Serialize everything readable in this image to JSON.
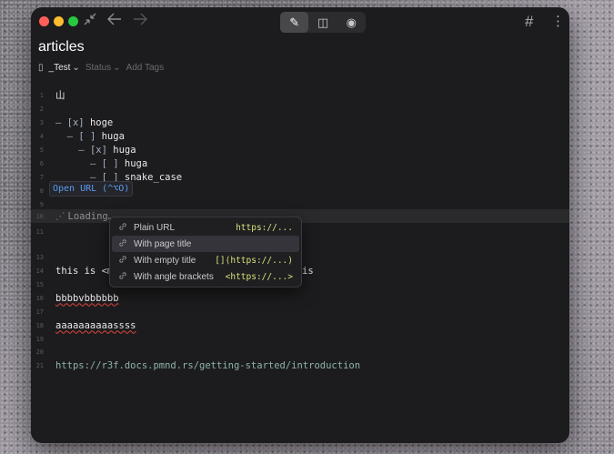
{
  "toolbar": {
    "collapse_icon": "collapse-arrows-icon",
    "back_icon": "arrow-left-icon",
    "forward_icon": "arrow-right-icon",
    "modes": [
      {
        "name": "edit",
        "icon": "pencil-icon",
        "glyph": "✎",
        "active": true
      },
      {
        "name": "split",
        "icon": "split-view-icon",
        "glyph": "◫",
        "active": false
      },
      {
        "name": "preview",
        "icon": "eye-icon",
        "glyph": "◉",
        "active": false
      }
    ],
    "hash_glyph": "#",
    "more_glyph": "⋮"
  },
  "note": {
    "title": "articles",
    "notebook": "_Test",
    "status": "Status",
    "add_tags": "Add Tags"
  },
  "editor": {
    "lines": [
      {
        "n": "1",
        "text": "山"
      },
      {
        "n": "2",
        "text": ""
      },
      {
        "n": "3",
        "text": "hoge",
        "dash": "– ",
        "check": "[x] ",
        "indent": ""
      },
      {
        "n": "4",
        "text": "huga",
        "dash": "– ",
        "check": "[ ] ",
        "indent": "  "
      },
      {
        "n": "5",
        "text": "huga",
        "dash": "– ",
        "check": "[x] ",
        "indent": "    "
      },
      {
        "n": "6",
        "text": "huga",
        "dash": "– ",
        "check": "[ ] ",
        "indent": "      "
      },
      {
        "n": "7",
        "text": "snake_case",
        "dash": "– ",
        "check": "[ ] ",
        "indent": "      "
      },
      {
        "n": "8",
        "text": ""
      },
      {
        "n": "9",
        "text": ""
      },
      {
        "n": "10",
        "text": "Loading…",
        "spinner": "⋰"
      },
      {
        "n": "11",
        "text": ""
      },
      {
        "n": "13",
        "text": ""
      },
      {
        "n": "14",
        "text_a": "this is <m",
        "text_b": "is"
      },
      {
        "n": "15",
        "text": ""
      },
      {
        "n": "16",
        "text": "bbbbvbbbbbb"
      },
      {
        "n": "17",
        "text": ""
      },
      {
        "n": "18",
        "text": "aaaaaaaaaassss"
      },
      {
        "n": "19",
        "text": ""
      },
      {
        "n": "20",
        "text": ""
      },
      {
        "n": "21",
        "text": "https://r3f.docs.pmnd.rs/getting-started/introduction"
      }
    ],
    "tooltip": "Open URL (^⌥O)"
  },
  "paste_menu": {
    "items": [
      {
        "label": "Plain URL",
        "preview": "https://...",
        "selected": false
      },
      {
        "label": "With page title",
        "preview": "",
        "selected": true
      },
      {
        "label": "With empty title",
        "preview": "[](https://...)",
        "selected": false
      },
      {
        "label": "With angle brackets",
        "preview": "<https://...>",
        "selected": false
      }
    ],
    "item_icon": "link-icon"
  }
}
